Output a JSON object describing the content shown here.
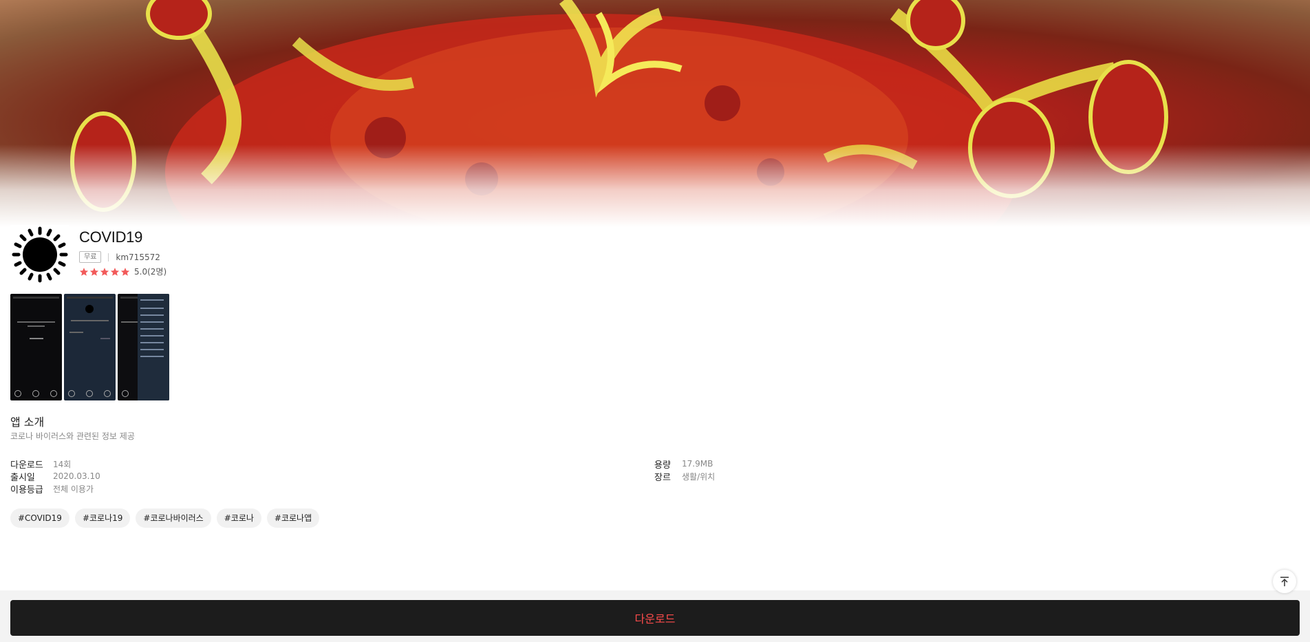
{
  "app": {
    "title": "COVID19",
    "price": "무료",
    "author": "km715572",
    "rating_value": 5,
    "rating_text": "5.0(2명)",
    "icon": "sun-gear-icon"
  },
  "screenshots": [
    {
      "name": "screenshot-1",
      "caption": "COVID19에 오신것을 환영합니다"
    },
    {
      "name": "screenshot-2",
      "caption": "전체"
    },
    {
      "name": "screenshot-3",
      "caption": "COVID19"
    }
  ],
  "intro": {
    "title": "앱 소개",
    "description": "코로나 바이러스와 관련된 정보 제공"
  },
  "info": {
    "left": [
      {
        "label": "다운로드",
        "value": "14회"
      },
      {
        "label": "출시일",
        "value": "2020.03.10"
      },
      {
        "label": "이용등급",
        "value": "전체 이용가"
      }
    ],
    "right": [
      {
        "label": "용량",
        "value": "17.9MB"
      },
      {
        "label": "장르",
        "value": "생활/위치"
      }
    ]
  },
  "tags": [
    "#COVID19",
    "#코로나19",
    "#코로나바이러스",
    "#코로나",
    "#코로나앱"
  ],
  "actions": {
    "download_label": "다운로드",
    "scroll_top_icon": "arrow-up-to-top-icon"
  },
  "colors": {
    "accent": "#ff4b4b",
    "star": "#f25a5a",
    "download_bg": "#1c1c1c"
  }
}
